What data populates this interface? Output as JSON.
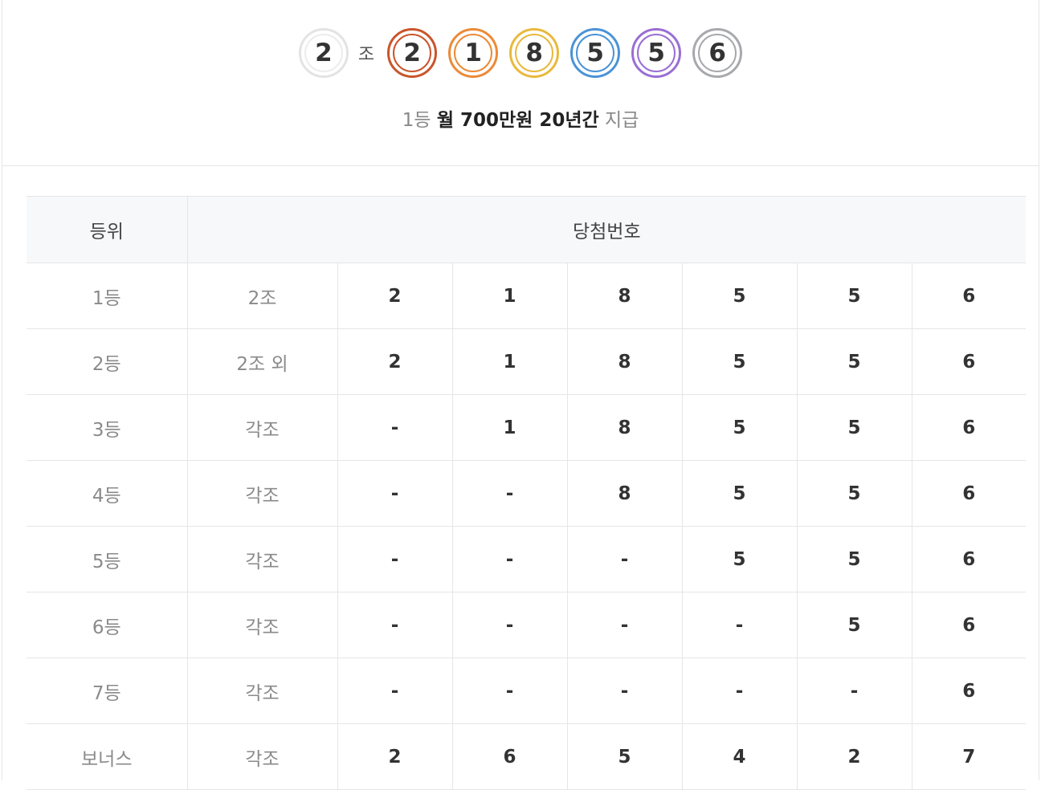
{
  "header": {
    "jo_number": "2",
    "jo_label": "조",
    "balls": [
      {
        "value": "2",
        "color": "#c9552c"
      },
      {
        "value": "1",
        "color": "#ec8a37"
      },
      {
        "value": "8",
        "color": "#e9b93d"
      },
      {
        "value": "5",
        "color": "#4b93d6"
      },
      {
        "value": "5",
        "color": "#9a6ed4"
      },
      {
        "value": "6",
        "color": "#a8a9ad"
      }
    ],
    "prize": {
      "rank": "1등",
      "amount_strong": "월 700만원 20년간",
      "suffix": "지급"
    }
  },
  "table": {
    "headers": {
      "rank": "등위",
      "numbers": "당첨번호"
    },
    "rows": [
      {
        "rank": "1등",
        "group": "2조",
        "digits": [
          "2",
          "1",
          "8",
          "5",
          "5",
          "6"
        ]
      },
      {
        "rank": "2등",
        "group": "2조 외",
        "digits": [
          "2",
          "1",
          "8",
          "5",
          "5",
          "6"
        ]
      },
      {
        "rank": "3등",
        "group": "각조",
        "digits": [
          "-",
          "1",
          "8",
          "5",
          "5",
          "6"
        ]
      },
      {
        "rank": "4등",
        "group": "각조",
        "digits": [
          "-",
          "-",
          "8",
          "5",
          "5",
          "6"
        ]
      },
      {
        "rank": "5등",
        "group": "각조",
        "digits": [
          "-",
          "-",
          "-",
          "5",
          "5",
          "6"
        ]
      },
      {
        "rank": "6등",
        "group": "각조",
        "digits": [
          "-",
          "-",
          "-",
          "-",
          "5",
          "6"
        ]
      },
      {
        "rank": "7등",
        "group": "각조",
        "digits": [
          "-",
          "-",
          "-",
          "-",
          "-",
          "6"
        ]
      },
      {
        "rank": "보너스",
        "group": "각조",
        "digits": [
          "2",
          "6",
          "5",
          "4",
          "2",
          "7"
        ]
      }
    ]
  }
}
